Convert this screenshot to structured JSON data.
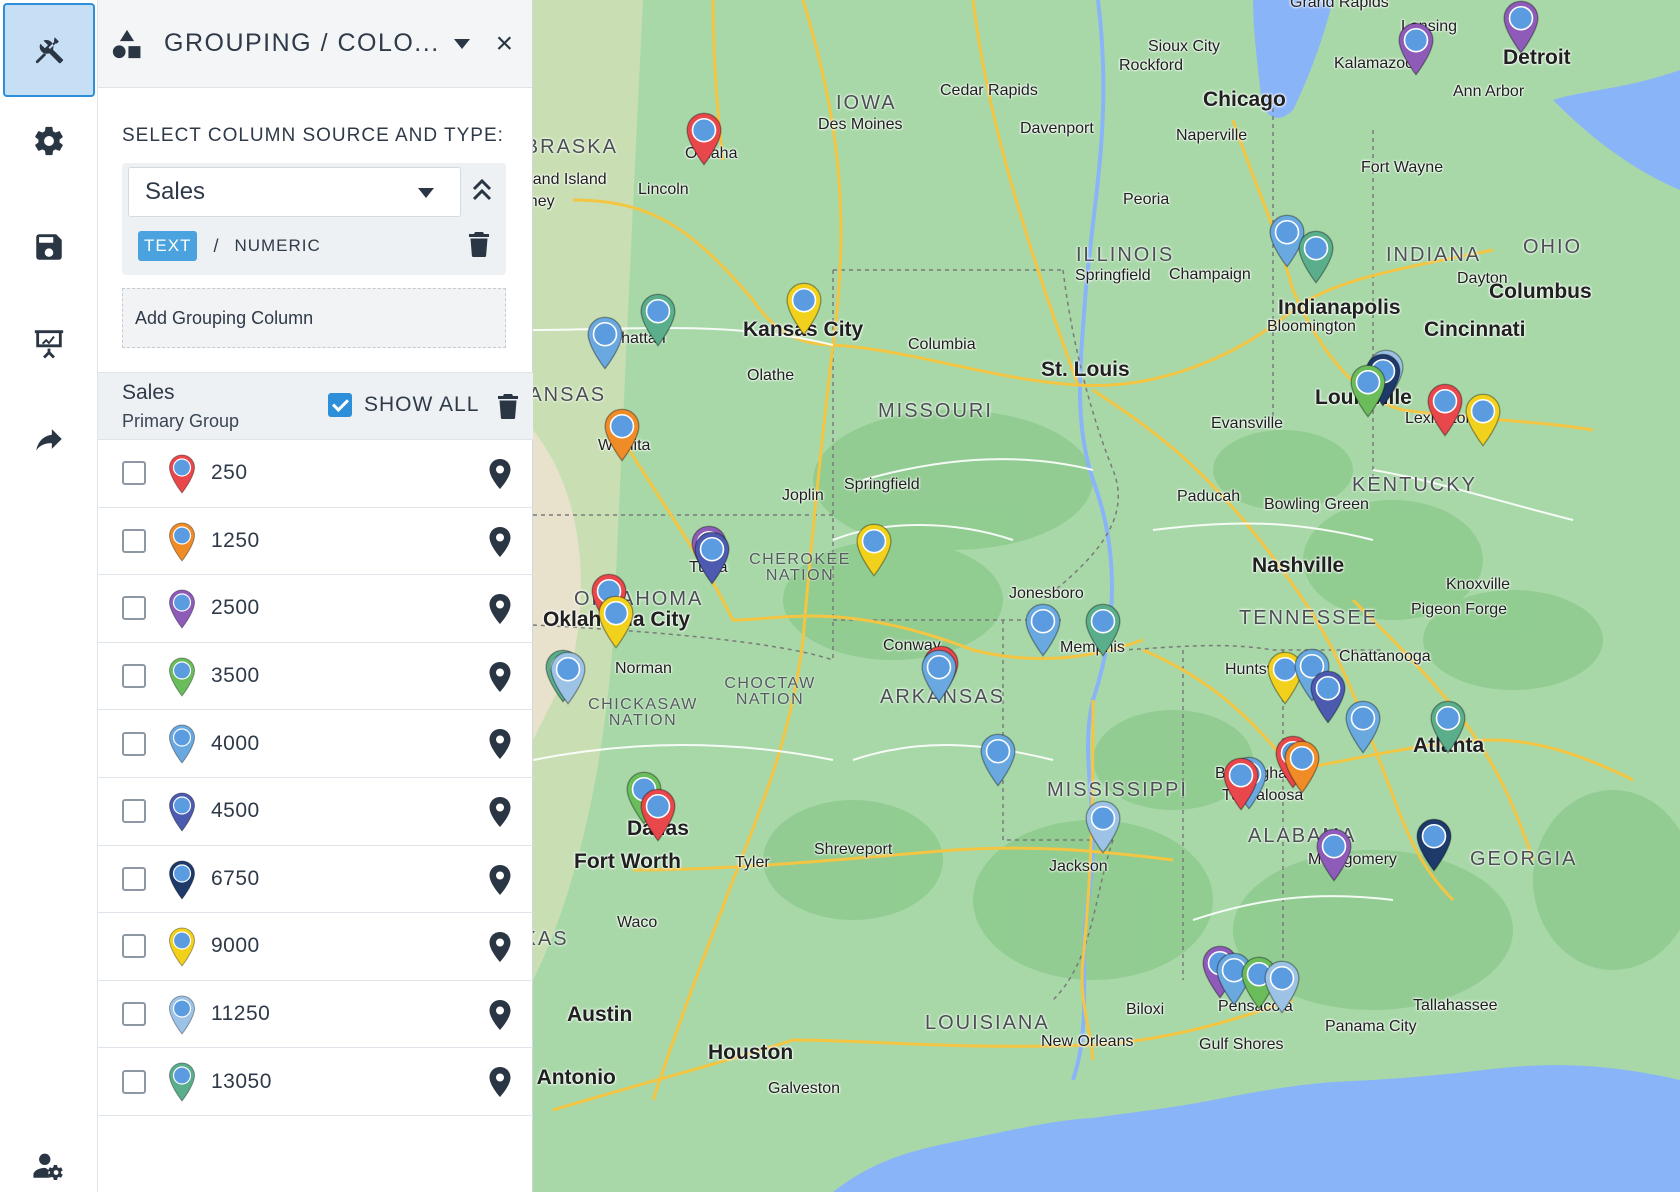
{
  "rail": {
    "items": [
      {
        "name": "tools-icon",
        "active": true
      },
      {
        "name": "gear-icon",
        "active": false
      },
      {
        "name": "save-icon",
        "active": false
      },
      {
        "name": "presentation-icon",
        "active": false
      },
      {
        "name": "share-icon",
        "active": false
      },
      {
        "name": "user-settings-icon",
        "active": false
      }
    ]
  },
  "panel": {
    "header_icon": "shapes-icon",
    "title": "GROUPING / COLO...",
    "close_label": "×",
    "source_label": "SELECT COLUMN SOURCE AND TYPE:",
    "source_value": "Sales",
    "type_text": "TEXT",
    "type_separator": "/",
    "type_numeric": "NUMERIC",
    "add_group_label": "Add Grouping Column",
    "group": {
      "name": "Sales",
      "subtitle": "Primary Group",
      "show_all_label": "SHOW ALL",
      "show_all_checked": true
    },
    "rows": [
      {
        "label": "250",
        "color": "#e8484c",
        "checked": false
      },
      {
        "label": "1250",
        "color": "#ef8c28",
        "checked": false
      },
      {
        "label": "2500",
        "color": "#8e5bb8",
        "checked": false
      },
      {
        "label": "3500",
        "color": "#6bbd5b",
        "checked": false
      },
      {
        "label": "4000",
        "color": "#6aa8e0",
        "checked": false
      },
      {
        "label": "4500",
        "color": "#4c5bb0",
        "checked": false
      },
      {
        "label": "6750",
        "color": "#1e3a6a",
        "checked": false
      },
      {
        "label": "9000",
        "color": "#f2d11c",
        "checked": false
      },
      {
        "label": "11250",
        "color": "#9cc3e6",
        "checked": false
      },
      {
        "label": "13050",
        "color": "#5aae8c",
        "checked": false
      }
    ]
  },
  "map": {
    "cities": [
      {
        "name": "Sioux City",
        "big": false
      },
      {
        "name": "Omaha",
        "big": false
      },
      {
        "name": "Lincoln",
        "big": false
      },
      {
        "name": "Grand Island",
        "big": false
      },
      {
        "name": "Kearney",
        "big": false
      },
      {
        "name": "Des Moines",
        "big": false
      },
      {
        "name": "Cedar Rapids",
        "big": false
      },
      {
        "name": "Rockford",
        "big": false
      },
      {
        "name": "Chicago",
        "big": true
      },
      {
        "name": "Naperville",
        "big": false
      },
      {
        "name": "Davenport",
        "big": false
      },
      {
        "name": "Peoria",
        "big": false
      },
      {
        "name": "Springfield",
        "big": false
      },
      {
        "name": "Champaign",
        "big": false
      },
      {
        "name": "Grand Rapids",
        "big": false
      },
      {
        "name": "Lansing",
        "big": false
      },
      {
        "name": "Kalamazoo",
        "big": false
      },
      {
        "name": "Detroit",
        "big": true
      },
      {
        "name": "Ann Arbor",
        "big": false
      },
      {
        "name": "Fort Wayne",
        "big": false
      },
      {
        "name": "Indianapolis",
        "big": true
      },
      {
        "name": "Bloomington",
        "big": false
      },
      {
        "name": "Dayton",
        "big": false
      },
      {
        "name": "Columbus",
        "big": true
      },
      {
        "name": "Cincinnati",
        "big": true
      },
      {
        "name": "Manhattan",
        "big": false
      },
      {
        "name": "Kansas City",
        "big": true
      },
      {
        "name": "Olathe",
        "big": false
      },
      {
        "name": "Columbia",
        "big": false
      },
      {
        "name": "St. Louis",
        "big": true
      },
      {
        "name": "Wichita",
        "big": false
      },
      {
        "name": "Joplin",
        "big": false
      },
      {
        "name": "Springfield",
        "big": false
      },
      {
        "name": "Evansville",
        "big": false
      },
      {
        "name": "Louisville",
        "big": true
      },
      {
        "name": "Lexington",
        "big": false
      },
      {
        "name": "Paducah",
        "big": false
      },
      {
        "name": "Bowling Green",
        "big": false
      },
      {
        "name": "Tulsa",
        "big": false
      },
      {
        "name": "Oklahoma City",
        "big": true
      },
      {
        "name": "Norman",
        "big": false
      },
      {
        "name": "Jonesboro",
        "big": false
      },
      {
        "name": "Memphis",
        "big": false
      },
      {
        "name": "Nashville",
        "big": true
      },
      {
        "name": "Knoxville",
        "big": false
      },
      {
        "name": "Pigeon Forge",
        "big": false
      },
      {
        "name": "Chattanooga",
        "big": false
      },
      {
        "name": "Huntsville",
        "big": false
      },
      {
        "name": "Conway",
        "big": false
      },
      {
        "name": "Atlanta",
        "big": true
      },
      {
        "name": "Birmingham",
        "big": false
      },
      {
        "name": "Tuscaloosa",
        "big": false
      },
      {
        "name": "Montgomery",
        "big": false
      },
      {
        "name": "Dallas",
        "big": true
      },
      {
        "name": "Fort Worth",
        "big": true
      },
      {
        "name": "Tyler",
        "big": false
      },
      {
        "name": "Shreveport",
        "big": false
      },
      {
        "name": "Jackson",
        "big": false
      },
      {
        "name": "Waco",
        "big": false
      },
      {
        "name": "Austin",
        "big": true
      },
      {
        "name": "Houston",
        "big": true
      },
      {
        "name": "San Antonio",
        "big": true
      },
      {
        "name": "Galveston",
        "big": false
      },
      {
        "name": "New Orleans",
        "big": false
      },
      {
        "name": "Biloxi",
        "big": false
      },
      {
        "name": "Pensacola",
        "big": false
      },
      {
        "name": "Gulf Shores",
        "big": false
      },
      {
        "name": "Tallahassee",
        "big": false
      },
      {
        "name": "Panama City",
        "big": false
      }
    ],
    "states": [
      "IOWA",
      "ILLINOIS",
      "INDIANA",
      "OHIO",
      "KANSAS",
      "MISSOURI",
      "KENTUCKY",
      "OKLAHOMA",
      "TENNESSEE",
      "ARKANSAS",
      "MISSISSIPPI",
      "ALABAMA",
      "GEORGIA",
      "LOUISIANA",
      "TEXAS",
      "NEBRASKA"
    ],
    "nations": [
      "CHEROKEE NATION",
      "CHOCTAW NATION",
      "CHICKASAW NATION"
    ],
    "markers": [
      {
        "color": "#e8484c"
      },
      {
        "color": "#f2d11c"
      },
      {
        "color": "#6aa8e0"
      },
      {
        "color": "#5aae8c"
      },
      {
        "color": "#ef8c28"
      },
      {
        "color": "#8e5bb8"
      },
      {
        "color": "#4c5bb0"
      },
      {
        "color": "#e8484c"
      },
      {
        "color": "#f2d11c"
      },
      {
        "color": "#5aae8c"
      },
      {
        "color": "#9cc3e6"
      },
      {
        "color": "#f2d11c"
      },
      {
        "color": "#e8484c"
      },
      {
        "color": "#6aa8e0"
      },
      {
        "color": "#6aa8e0"
      },
      {
        "color": "#5aae8c"
      },
      {
        "color": "#6aa8e0"
      },
      {
        "color": "#9cc3e6"
      },
      {
        "color": "#6aa8e0"
      },
      {
        "color": "#5aae8c"
      },
      {
        "color": "#9cc3e6"
      },
      {
        "color": "#1e3a6a"
      },
      {
        "color": "#6bbd5b"
      },
      {
        "color": "#e8484c"
      },
      {
        "color": "#f2d11c"
      },
      {
        "color": "#8e5bb8"
      },
      {
        "color": "#8e5bb8"
      },
      {
        "color": "#f2d11c"
      },
      {
        "color": "#6aa8e0"
      },
      {
        "color": "#4c5bb0"
      },
      {
        "color": "#6aa8e0"
      },
      {
        "color": "#6bbd5b"
      },
      {
        "color": "#e8484c"
      },
      {
        "color": "#e8484c"
      },
      {
        "color": "#ef8c28"
      },
      {
        "color": "#6aa8e0"
      },
      {
        "color": "#8e5bb8"
      },
      {
        "color": "#1e3a6a"
      },
      {
        "color": "#e8484c"
      },
      {
        "color": "#8e5bb8"
      },
      {
        "color": "#6aa8e0"
      },
      {
        "color": "#6bbd5b"
      },
      {
        "color": "#9cc3e6"
      },
      {
        "color": "#5aae8c"
      }
    ]
  }
}
